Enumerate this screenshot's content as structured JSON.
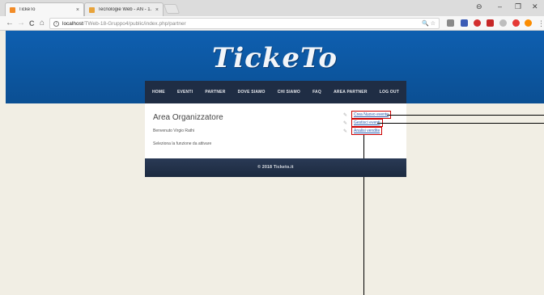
{
  "browser": {
    "tabs": [
      {
        "title": "TickeTo",
        "close": "×",
        "fav_color": "#f28c28"
      },
      {
        "title": "Tecnologie Web - AN - 1.",
        "close": "×",
        "fav_color": "#e8a33a"
      }
    ],
    "window_controls": {
      "account": "⊖",
      "minimize": "–",
      "restore": "❐",
      "close": "✕"
    },
    "nav": {
      "back": "←",
      "forward": "→",
      "reload": "C",
      "home": "⌂"
    },
    "address": {
      "info": "i",
      "host": "localhost",
      "path": "/TWeb-18-Gruppo4/public/index.php/partner"
    },
    "address_icons": "🔍 ☆",
    "menu": "⋮"
  },
  "site": {
    "logo": "TickeTo",
    "menu": [
      "HOME",
      "EVENTI",
      "PARTNER",
      "DOVE SIAMO",
      "CHI SIAMO",
      "FAQ",
      "AREA PARTNER",
      "LOG OUT"
    ],
    "content": {
      "title": "Area Organizzatore",
      "welcome": "Benvenuto Virgio Rathi",
      "hint": "Seleziona la funzione da attivare"
    },
    "actions": [
      {
        "icon": "✎",
        "label": "Crea Nuovo evento"
      },
      {
        "icon": "✎",
        "label": "Gestisci eventi"
      },
      {
        "icon": "✎",
        "label": "Analisi vendite"
      }
    ],
    "footer": "© 2018 Ticketo.it"
  },
  "colors": {
    "header": "#0b4f93",
    "menu_bg": "#1f2d44",
    "page_bg": "#f1eee4",
    "highlight": "#cc0000"
  }
}
